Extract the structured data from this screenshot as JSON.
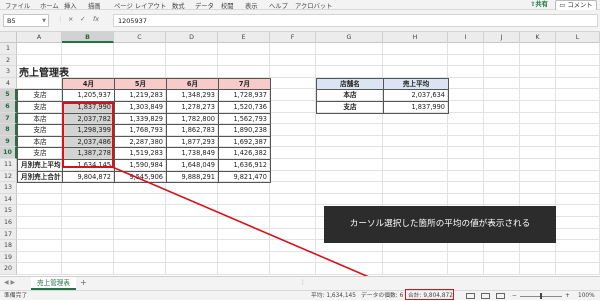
{
  "ribbon": {
    "tabs": [
      "ファイル",
      "ホーム",
      "挿入",
      "描画",
      "ページ レイアウト",
      "数式",
      "データ",
      "校閲",
      "表示",
      "ヘルプ",
      "アクロバット"
    ],
    "share_label": "共有",
    "comment_label": "コメント"
  },
  "formula_bar": {
    "name_box": "B5",
    "fx_symbol": "fx",
    "cancel_symbol": "×",
    "enter_symbol": "✓",
    "value": "1205937"
  },
  "columns": [
    "A",
    "B",
    "C",
    "D",
    "E",
    "F",
    "G",
    "H",
    "I",
    "J",
    "K",
    "L"
  ],
  "rows": [
    "1",
    "2",
    "3",
    "4",
    "5",
    "6",
    "7",
    "8",
    "9",
    "10",
    "11",
    "12",
    "13",
    "14",
    "15",
    "16",
    "17",
    "18",
    "19",
    "20"
  ],
  "sheet": {
    "title": "売上管理表",
    "month_headers": [
      "4月",
      "5月",
      "6月",
      "7月"
    ],
    "data_rows": [
      {
        "store": "支店",
        "values": [
          "1,205,937",
          "1,219,283",
          "1,348,293",
          "1,728,937"
        ]
      },
      {
        "store": "支店",
        "values": [
          "1,837,990",
          "1,303,849",
          "1,278,273",
          "1,520,736"
        ]
      },
      {
        "store": "本店",
        "values": [
          "2,037,782",
          "1,339,829",
          "1,782,800",
          "1,562,793"
        ]
      },
      {
        "store": "支店",
        "values": [
          "1,298,399",
          "1,768,793",
          "1,862,783",
          "1,890,238"
        ]
      },
      {
        "store": "本店",
        "values": [
          "2,037,486",
          "2,287,380",
          "1,877,293",
          "1,692,387"
        ]
      },
      {
        "store": "支店",
        "values": [
          "1,387,278",
          "1,519,283",
          "1,738,849",
          "1,426,382"
        ]
      }
    ],
    "avg_row": {
      "label": "月別売上平均",
      "values": [
        "1,634,145",
        "1,590,984",
        "1,648,049",
        "1,636,912"
      ]
    },
    "total_row": {
      "label": "月別売上合計",
      "values": [
        "9,804,872",
        "9,545,906",
        "9,888,291",
        "9,821,470"
      ]
    },
    "summary_table": {
      "headers": [
        "店舗名",
        "売上平均"
      ],
      "rows": [
        [
          "本店",
          "2,037,634"
        ],
        [
          "支店",
          "1,837,990"
        ]
      ]
    }
  },
  "annotation": {
    "callout_text": "カーソル選択した箇所の平均の値が表示される"
  },
  "sheet_tabs": {
    "active": "売上管理表",
    "add_symbol": "+"
  },
  "status_bar": {
    "ready": "準備完了",
    "average": "平均: 1,634,145",
    "count": "データの個数: 6",
    "sum": "合計: 9,804,872",
    "zoom": "100%"
  },
  "colors": {
    "accent": "#217346",
    "highlight_red": "#d2141c",
    "month_header_bg": "#f8cbcb",
    "summary_header_bg": "#dbe4f2"
  }
}
